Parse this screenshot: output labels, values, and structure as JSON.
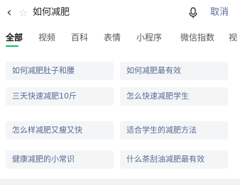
{
  "header": {
    "back_icon": "chevron-left-icon",
    "star_icon": "star-outline-icon",
    "query": "如何减肥",
    "mic_icon": "microphone-icon",
    "cancel_label": "取消"
  },
  "tabs": [
    {
      "label": "全部",
      "active": true
    },
    {
      "label": "视频"
    },
    {
      "label": "百科"
    },
    {
      "label": "表情"
    },
    {
      "label": "小程序"
    },
    {
      "label": "微信指数"
    },
    {
      "label": "视"
    }
  ],
  "suggestions": [
    "如何减肥肚子和腰",
    "如何减肥最有效",
    "三天快速减肥10斤",
    "怎么快速减肥学生",
    "怎么样减肥又瘦又快",
    "适合学生的减肥方法",
    "健康减肥的小常识",
    "什么茶刮油减肥最有效"
  ],
  "colors": {
    "accent": "#07c160",
    "link": "#576b95",
    "chip_bg": "#f4f5f7"
  }
}
